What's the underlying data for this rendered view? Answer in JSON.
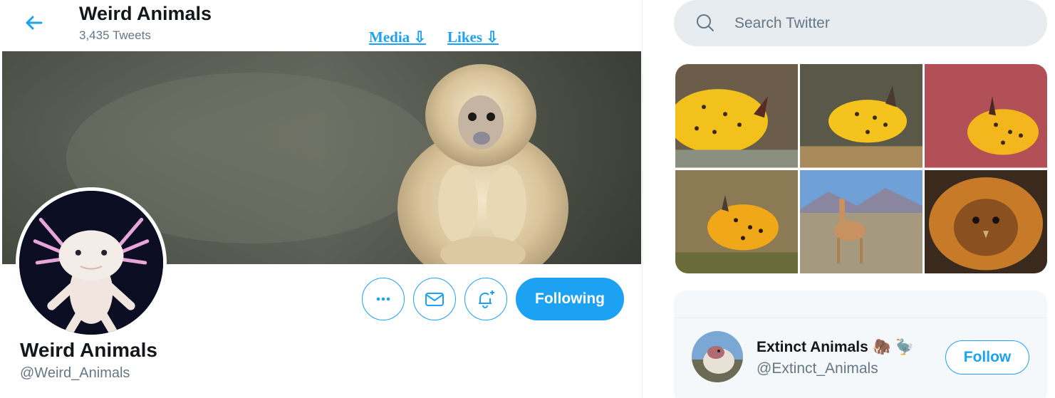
{
  "header": {
    "title": "Weird Animals",
    "tweet_count": "3,435 Tweets",
    "links": [
      {
        "label": "Media ⇩"
      },
      {
        "label": "Likes ⇩"
      }
    ]
  },
  "profile": {
    "name": "Weird Animals",
    "handle": "@Weird_Animals",
    "following_label": "Following"
  },
  "search": {
    "placeholder": "Search Twitter"
  },
  "who_to_follow": {
    "name": "Extinct Animals 🦣 🦤",
    "handle": "@Extinct_Animals",
    "follow_label": "Follow"
  },
  "colors": {
    "accent": "#1da1f2",
    "secondary_text": "#657786",
    "search_bg": "#e6ecf0"
  },
  "icons": {
    "back": "arrow-left-icon",
    "more": "more-dots-icon",
    "message": "envelope-icon",
    "notify": "bell-plus-icon",
    "search": "search-icon"
  }
}
